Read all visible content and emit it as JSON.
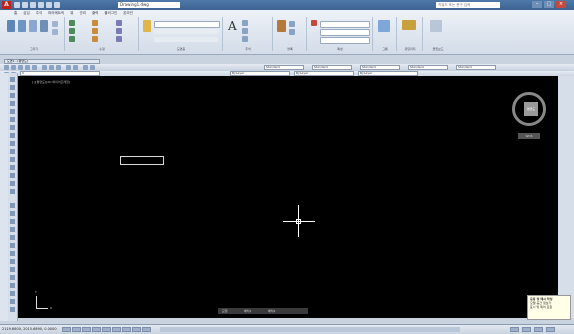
{
  "app": {
    "logo_letter": "A",
    "document_title": "Drawing1.dwg"
  },
  "search": {
    "placeholder": "키워드 또는 문구 입력"
  },
  "ribbon": {
    "tabs": [
      "홈",
      "삽입",
      "주석",
      "파라메트릭",
      "뷰",
      "관리",
      "출력",
      "플러그인",
      "온라인"
    ],
    "panels": [
      "그리기",
      "수정",
      "도면층",
      "주석",
      "블록",
      "특성",
      "그룹",
      "유틸리티",
      "클립보드"
    ]
  },
  "file_tab": {
    "label": "도면1 - [평면도]"
  },
  "toolbars": {
    "layer_combo": "0",
    "style_combo": "Standard",
    "color_combo": "ByLayer",
    "linetype_combo": "ByLayer",
    "lineweight_combo": "ByLayer"
  },
  "viewport": {
    "label": "[-][평면도][2D 와이어프레임]",
    "viewcube_face": "평면도",
    "wcs": "WCS"
  },
  "ucs": {
    "x": "X",
    "y": "Y"
  },
  "layout_tabs": [
    "모형",
    "배치1",
    "배치2"
  ],
  "status": {
    "coordinates": "2119.8600, 2015.6890, 0.0000"
  },
  "tooltip": {
    "lines": [
      "응용 및 메시 작성",
      "모델 공간 정보가",
      "표시 및 제어 포함"
    ]
  },
  "colors": {
    "ribbon_accent": "#4f79a8",
    "canvas": "#000000",
    "logo": "#c0221c"
  }
}
